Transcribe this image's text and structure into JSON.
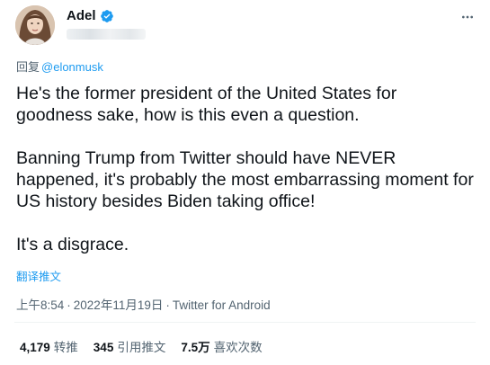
{
  "author": {
    "display_name": "Adel",
    "verified_icon": "verified-badge-icon",
    "handle_obscured": true
  },
  "reply": {
    "prefix": "回复",
    "mention": "@elonmusk"
  },
  "tweet": {
    "paragraphs": [
      "He's the former president of the United States for goodness sake, how is this even a question.",
      "Banning Trump from Twitter should have NEVER happened, it's probably the most embarrassing moment for US history besides Biden taking office!",
      "It's a disgrace."
    ]
  },
  "translate_label": "翻译推文",
  "meta": {
    "time": "上午8:54",
    "separator": "·",
    "date": "2022年11月19日",
    "source": "Twitter for Android"
  },
  "stats": {
    "retweets": {
      "value": "4,179",
      "label": "转推"
    },
    "quotes": {
      "value": "345",
      "label": "引用推文"
    },
    "likes": {
      "value": "7.5万",
      "label": "喜欢次数"
    }
  },
  "colors": {
    "accent": "#1d9bf0",
    "text_primary": "#0f1419",
    "text_secondary": "#536471"
  }
}
